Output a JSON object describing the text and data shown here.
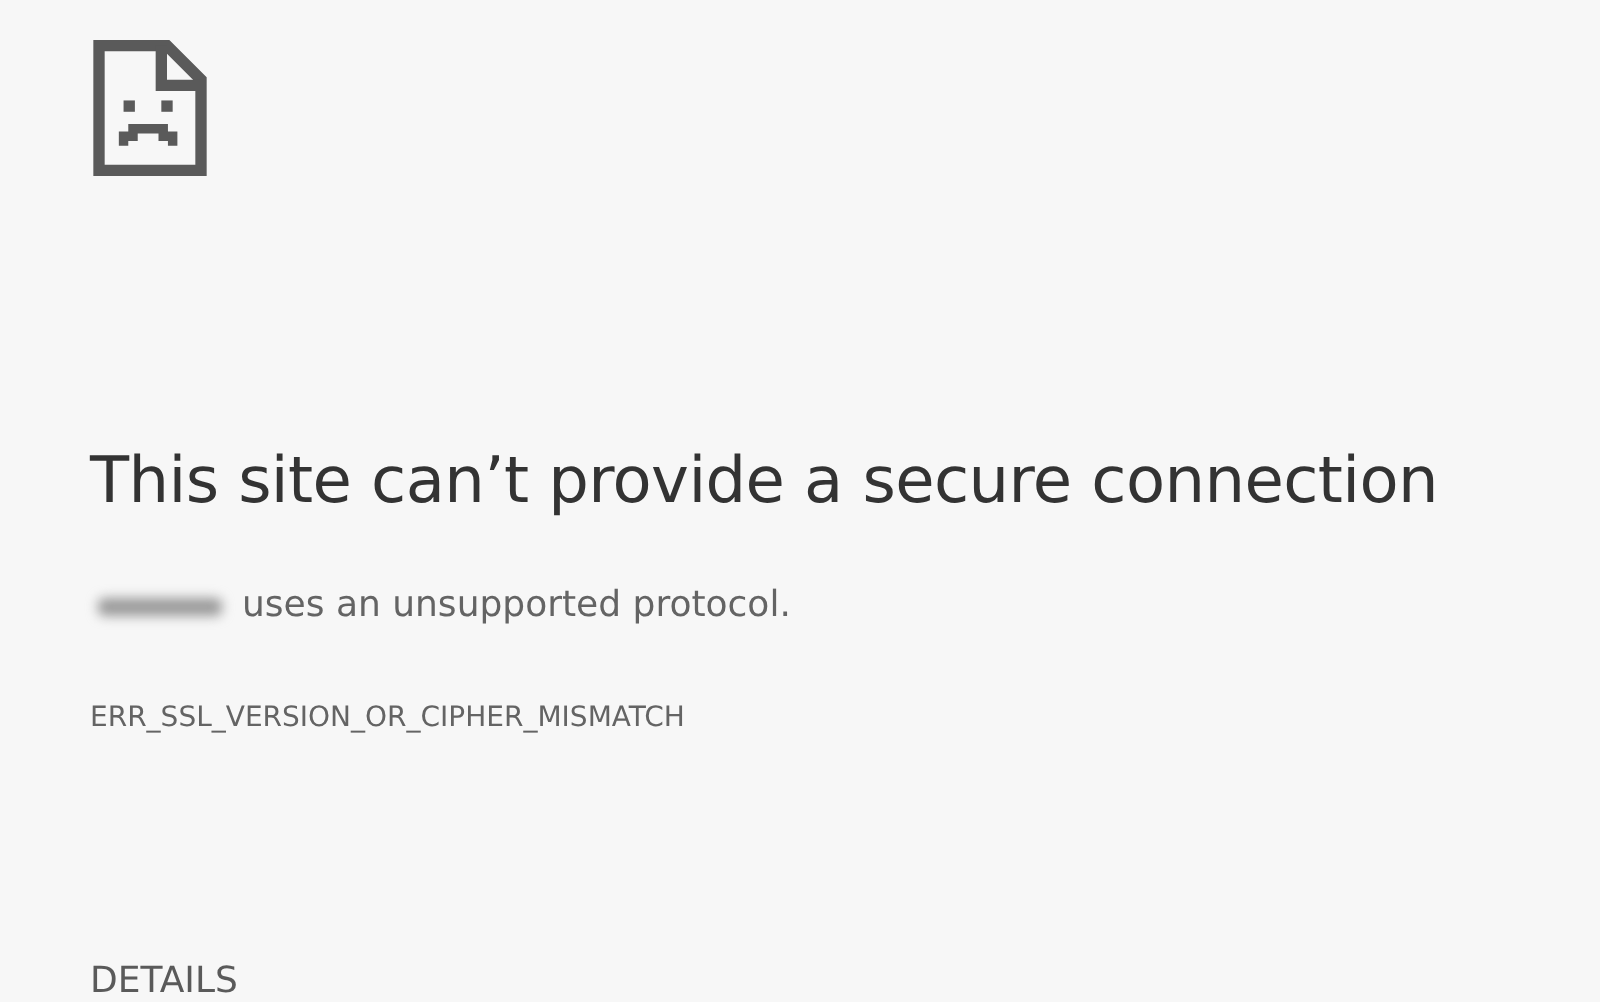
{
  "heading": "This site can’t provide a secure connection",
  "message": {
    "host_redacted": true,
    "text": "uses an unsupported protocol."
  },
  "error_code": "ERR_SSL_VERSION_OR_CIPHER_MISMATCH",
  "details_button": "DETAILS"
}
